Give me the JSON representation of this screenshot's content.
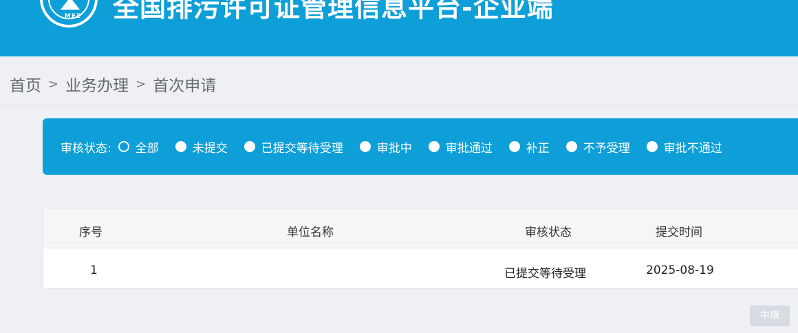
{
  "header": {
    "logo_text": "MEE",
    "title": "全国排污许可证管理信息平台-企业端"
  },
  "breadcrumb": {
    "items": [
      "首页",
      "业务办理",
      "首次申请"
    ],
    "separator": ">"
  },
  "filter": {
    "label": "审核状态:",
    "options": [
      {
        "label": "全部",
        "selected": true
      },
      {
        "label": "未提交",
        "selected": false
      },
      {
        "label": "已提交等待受理",
        "selected": false
      },
      {
        "label": "审批中",
        "selected": false
      },
      {
        "label": "审批通过",
        "selected": false
      },
      {
        "label": "补正",
        "selected": false
      },
      {
        "label": "不予受理",
        "selected": false
      },
      {
        "label": "审批不通过",
        "selected": false
      }
    ]
  },
  "table": {
    "columns": [
      "序号",
      "单位名称",
      "审核状态",
      "提交时间"
    ],
    "rows": [
      {
        "index": "1",
        "unit_name": "",
        "status": "已提交等待受理",
        "submit_time": "2025-08-19"
      }
    ]
  },
  "watermark": "中旗",
  "colors": {
    "header_bg": "#0e9fd8",
    "page_bg": "#eef0f3"
  }
}
